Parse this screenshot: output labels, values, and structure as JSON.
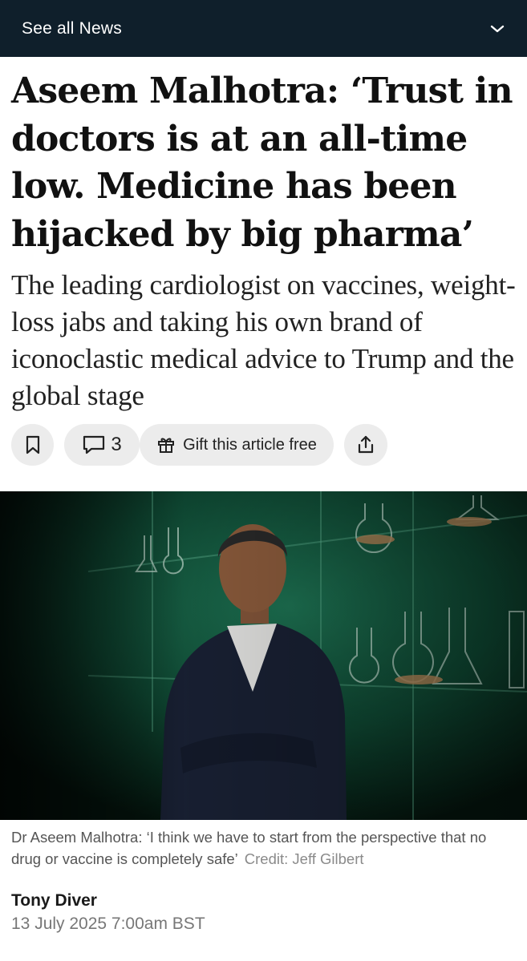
{
  "nav": {
    "label": "See all News",
    "toggle_icon": "chevron-down-icon"
  },
  "article": {
    "headline": "Aseem Malhotra: ‘Trust in doctors is at an all-time low. Medicine has been hijacked by big pharma’",
    "standfirst": "The leading cardiologist on vaccines, weight-loss jabs and taking his own brand of iconoclastic medical advice to Trump and the global stage"
  },
  "actions": {
    "bookmark_icon": "bookmark-icon",
    "comments_icon": "comment-icon",
    "comment_count": "3",
    "gift_icon": "gift-icon",
    "gift_label": "Gift this article free",
    "share_icon": "share-icon"
  },
  "image": {
    "caption": "Dr Aseem Malhotra: ‘I think we have to start from the perspective that no drug or vaccine is completely safe’",
    "credit": "Credit: Jeff Gilbert"
  },
  "author": {
    "name": "Tony Diver",
    "date": "13 July 2025 7:00am BST"
  },
  "colors": {
    "nav_bg": "#0f1f2b",
    "pill_bg": "#ececec",
    "photo_green": "#14573f"
  }
}
